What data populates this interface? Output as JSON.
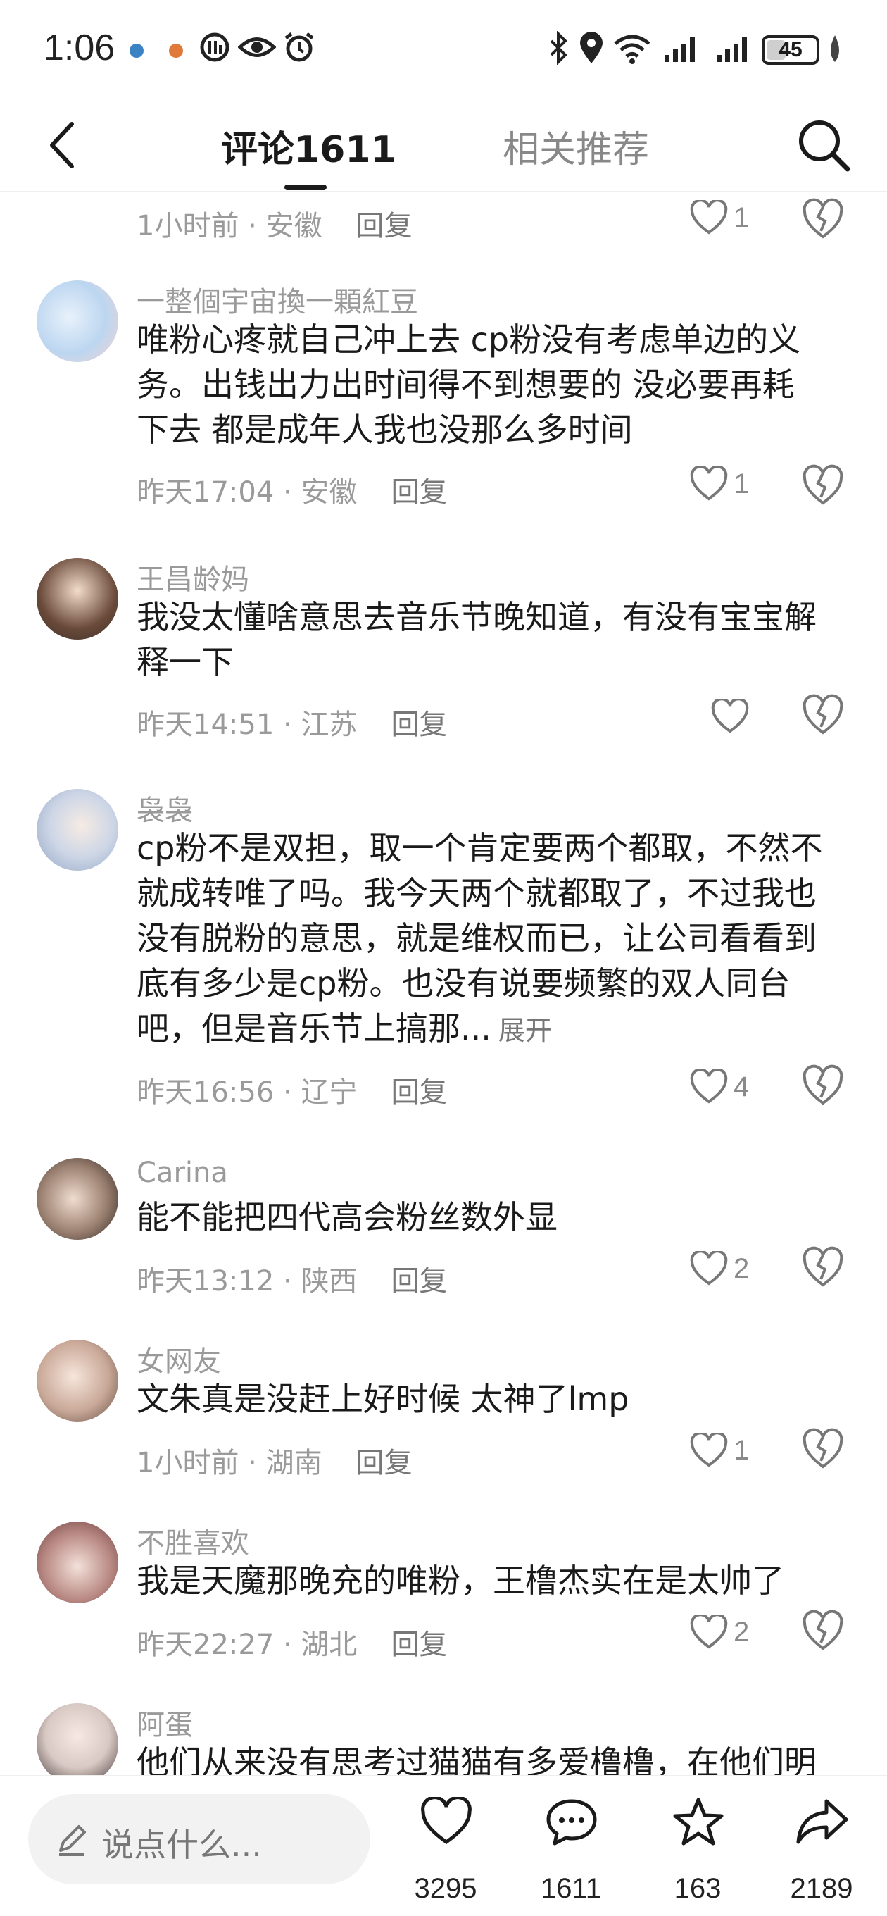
{
  "status_bar": {
    "time": "1:06",
    "battery": "45",
    "battery_level": 0.45
  },
  "header": {
    "tab_comments": "评论1611",
    "tab_related": "相关推荐"
  },
  "top_partial": {
    "time": "1小时前",
    "location": "安徽",
    "reply": "回复",
    "likes": "1"
  },
  "comments": [
    {
      "user": "一整個宇宙換一顆紅豆",
      "lines": [
        "唯粉心疼就自己冲上去 cp粉没有考虑单边的义",
        "务。出钱出力出时间得不到想要的 没必要再耗",
        "下去 都是成年人我也没那么多时间"
      ],
      "time": "昨天17:04",
      "location": "安徽",
      "reply": "回复",
      "likes": "1"
    },
    {
      "user": "王昌龄妈",
      "lines": [
        "我没太懂啥意思去音乐节晚知道，有没有宝宝解",
        "释一下"
      ],
      "time": "昨天14:51",
      "location": "江苏",
      "reply": "回复",
      "likes": ""
    },
    {
      "user": "袅袅",
      "lines": [
        "cp粉不是双担，取一个肯定要两个都取，不然不",
        "就成转唯了吗。我今天两个就都取了，不过我也",
        "没有脱粉的意思，就是维权而已，让公司看看到",
        "底有多少是cp粉。也没有说要频繁的双人同台",
        "吧，但是音乐节上搞那..."
      ],
      "expand": "展开",
      "time": "昨天16:56",
      "location": "辽宁",
      "reply": "回复",
      "likes": "4"
    },
    {
      "user": "Carina",
      "lines": [
        "能不能把四代高会粉丝数外显"
      ],
      "time": "昨天13:12",
      "location": "陕西",
      "reply": "回复",
      "likes": "2"
    },
    {
      "user": "女网友",
      "lines": [
        "文朱真是没赶上好时候 太神了lmp"
      ],
      "time": "1小时前",
      "location": "湖南",
      "reply": "回复",
      "likes": "1"
    },
    {
      "user": "不胜喜欢",
      "lines": [
        "我是天魔那晚充的唯粉，王橹杰实在是太帅了"
      ],
      "time": "昨天22:27",
      "location": "湖北",
      "reply": "回复",
      "likes": "2"
    },
    {
      "user": "阿蛋",
      "lines": [
        "他们从来没有思考过猫猫有多爱橹橹，在他们明"
      ]
    }
  ],
  "bottom_bar": {
    "input_placeholder": "说点什么...",
    "like_count": "3295",
    "comment_count": "1611",
    "favorite_count": "163",
    "share_count": "2189"
  },
  "colors": {
    "text": "#1a1a1a",
    "meta": "#9a9a9a",
    "input_bg": "#f2f2f2"
  }
}
